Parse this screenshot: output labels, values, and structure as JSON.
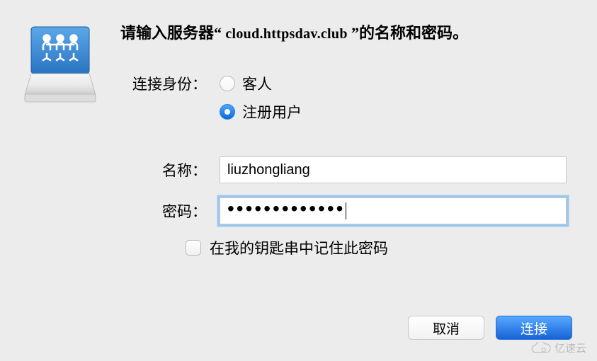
{
  "header": {
    "prefix": "请输入服务器",
    "open_quote": "“",
    "host": " cloud.httpsdav.club ",
    "close_quote": "”",
    "suffix": "的名称和密码。"
  },
  "connect_as": {
    "label": "连接身份：",
    "options": {
      "guest": "客人",
      "registered": "注册用户"
    },
    "selected": "registered"
  },
  "fields": {
    "name_label": "名称：",
    "name_value": "liuzhongliang",
    "password_label": "密码：",
    "password_dots": "•••••••••••••"
  },
  "remember": {
    "label": "在我的钥匙串中记住此密码",
    "checked": false
  },
  "buttons": {
    "cancel": "取消",
    "connect": "连接"
  },
  "watermark": "亿速云"
}
